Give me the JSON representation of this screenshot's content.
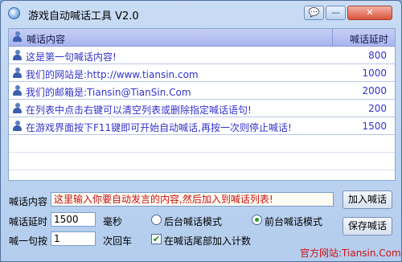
{
  "window": {
    "title": "游戏自动喊话工具 V2.0"
  },
  "titlebar_buttons": [
    "💬",
    "—",
    "✕"
  ],
  "list": {
    "col_content": "喊话内容",
    "col_delay": "喊话延时",
    "rows": [
      {
        "text": "这是第一句喊话内容!",
        "delay": "800"
      },
      {
        "text": "我们的网站是:http://www.tiansin.com",
        "delay": "1000"
      },
      {
        "text": "我们的邮箱是:Tiansin@TianSin.Com",
        "delay": "2000"
      },
      {
        "text": "在列表中点击右键可以清空列表或删除指定喊话语句!",
        "delay": "200"
      },
      {
        "text": "在游戏界面按下F11键即可开始自动喊话,再按一次则停止喊话!",
        "delay": "1500"
      }
    ]
  },
  "form": {
    "content_label": "喊话内容",
    "content_value": "这里输入你要自动发言的内容,然后加入到喊话列表!",
    "add_button": "加入喊话",
    "delay_label": "喊话延时",
    "delay_value": "1500",
    "delay_unit": "毫秒",
    "mode_background": "后台喊话模式",
    "mode_foreground": "前台喊话模式",
    "selected_mode": "前台喊话模式",
    "save_button": "保存喊话",
    "count_label": "喊一句按",
    "count_value": "1",
    "count_unit": "次回车",
    "append_count_label": "在喊话尾部加入计数",
    "append_count_checked": true,
    "website": "官方网站:Tiansin.Com"
  }
}
